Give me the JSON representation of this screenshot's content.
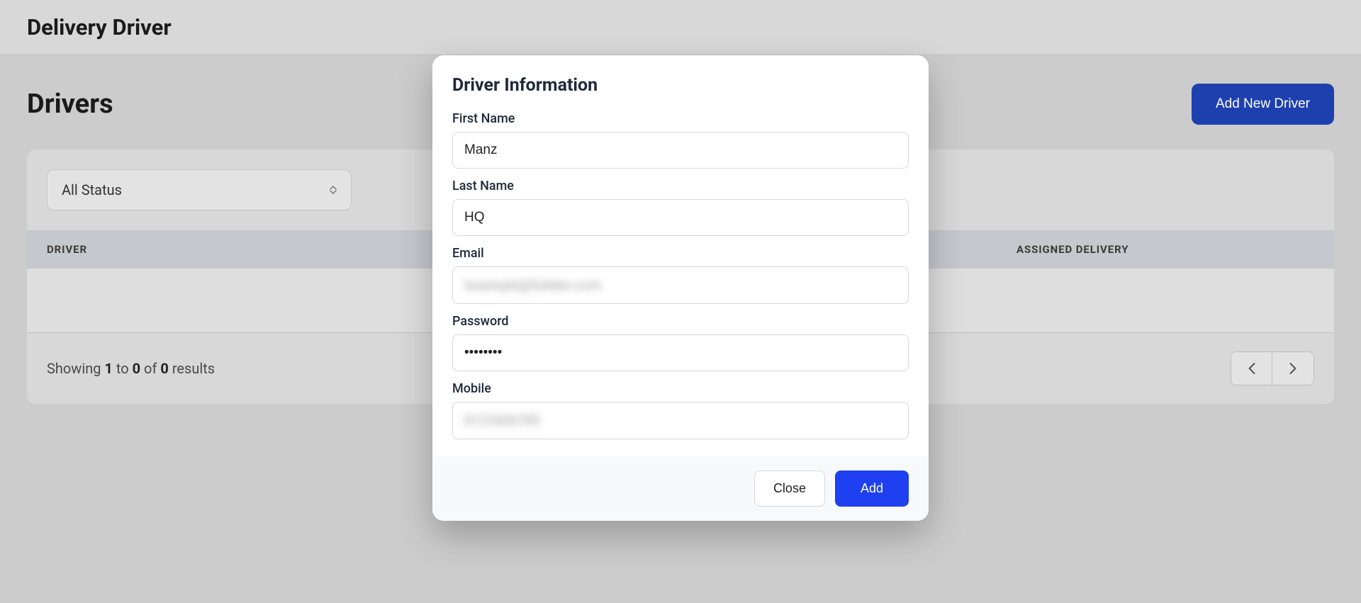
{
  "header": {
    "title": "Delivery Driver"
  },
  "page": {
    "title": "Drivers",
    "add_button": "Add New Driver"
  },
  "filter": {
    "status_selected": "All Status"
  },
  "table": {
    "headers": {
      "driver": "DRIVER",
      "assigned": "ASSIGNED DELIVERY"
    }
  },
  "pagination": {
    "text_prefix": "Showing ",
    "from": "1",
    "mid1": " to ",
    "to": "0",
    "mid2": " of ",
    "total": "0",
    "suffix": " results"
  },
  "modal": {
    "title": "Driver Information",
    "fields": {
      "first_name_label": "First Name",
      "first_name_value": "Manz",
      "last_name_label": "Last Name",
      "last_name_value": "HQ",
      "email_label": "Email",
      "email_value": "Iexample@hidden.com",
      "password_label": "Password",
      "password_value": "••••••••",
      "mobile_label": "Mobile",
      "mobile_value": "0123456789"
    },
    "buttons": {
      "close": "Close",
      "add": "Add"
    }
  }
}
